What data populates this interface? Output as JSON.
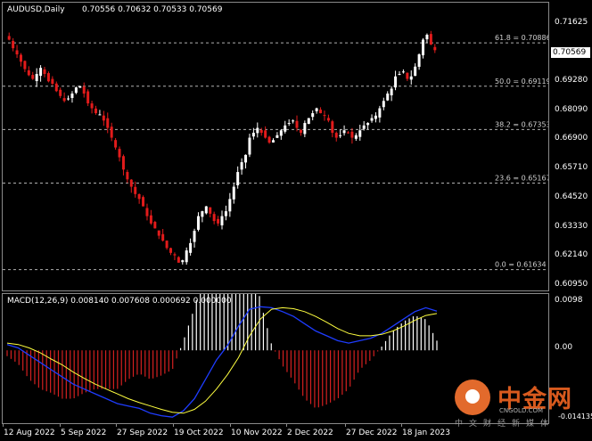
{
  "chart": {
    "symbol_label": "AUDUSD,Daily",
    "ohlc_label": "0.70556 0.70632 0.70533 0.70569",
    "current_price": "0.70569",
    "price_axis_labels": [
      "0.71625",
      "0.70569",
      "0.69280",
      "0.68090",
      "0.66900",
      "0.65710",
      "0.64520",
      "0.63330",
      "0.62140",
      "0.60950"
    ],
    "fib_levels": [
      {
        "label": "61.8 = 0.70886",
        "value": 0.70886
      },
      {
        "label": "50.0 = 0.69119",
        "value": 0.69119
      },
      {
        "label": "38.2 = 0.67353",
        "value": 0.67353
      },
      {
        "label": "23.6 = 0.65167",
        "value": 0.65167
      },
      {
        "label": "0.0 = 0.61634",
        "value": 0.61634
      }
    ],
    "date_labels": [
      "12 Aug 2022",
      "5 Sep 2022",
      "27 Sep 2022",
      "19 Oct 2022",
      "10 Nov 2022",
      "2 Dec 2022",
      "27 Dec 2022",
      "18 Jan 2023"
    ],
    "colors": {
      "bull": "#ffffff",
      "bear": "#e21b1b",
      "fib": "#b0b0b0",
      "macd_line": "#1e3cff",
      "signal_line": "#ffff40",
      "hist_pos": "#ffffff",
      "hist_neg": "#d42020",
      "frame": "#8a8a8a"
    }
  },
  "macd": {
    "label": "MACD(12,26,9) 0.008140 0.007608 0.000692 0.000000",
    "axis_labels": [
      "0.0098",
      "0.00",
      "-0.014135"
    ]
  },
  "watermark": {
    "name": "中金网",
    "url": "CNGOLD.COM",
    "slogan": "中文财经新媒体",
    "icon": "cngold-logo-icon"
  },
  "chart_data": [
    {
      "type": "candlestick",
      "title": "AUDUSD,Daily",
      "x_range": [
        "12 Aug 2022",
        "24 Jan 2023"
      ],
      "ylim": [
        0.6095,
        0.72
      ],
      "close_path": [
        0.71,
        0.7065,
        0.704,
        0.701,
        0.698,
        0.6955,
        0.694,
        0.696,
        0.6985,
        0.696,
        0.693,
        0.692,
        0.689,
        0.687,
        0.685,
        0.686,
        0.688,
        0.6905,
        0.691,
        0.688,
        0.684,
        0.682,
        0.68,
        0.6795,
        0.677,
        0.674,
        0.67,
        0.666,
        0.662,
        0.657,
        0.653,
        0.65,
        0.647,
        0.645,
        0.642,
        0.638,
        0.635,
        0.633,
        0.63,
        0.628,
        0.625,
        0.623,
        0.622,
        0.619,
        0.62,
        0.624,
        0.627,
        0.632,
        0.638,
        0.64,
        0.642,
        0.639,
        0.636,
        0.635,
        0.638,
        0.64,
        0.645,
        0.65,
        0.656,
        0.66,
        0.663,
        0.67,
        0.672,
        0.674,
        0.672,
        0.67,
        0.668,
        0.669,
        0.671,
        0.673,
        0.675,
        0.676,
        0.677,
        0.674,
        0.672,
        0.676,
        0.678,
        0.68,
        0.682,
        0.68,
        0.679,
        0.677,
        0.672,
        0.67,
        0.671,
        0.673,
        0.672,
        0.67,
        0.671,
        0.673,
        0.675,
        0.676,
        0.678,
        0.679,
        0.682,
        0.685,
        0.688,
        0.69,
        0.695,
        0.696,
        0.697,
        0.694,
        0.695,
        0.699,
        0.704,
        0.71,
        0.712,
        0.708,
        0.7057
      ]
    },
    {
      "type": "line",
      "title": "MACD(12,26,9)",
      "ylim": [
        -0.014135,
        0.0098
      ],
      "series": [
        {
          "name": "MACD",
          "values": [
            0.0012,
            0.0005,
            -0.001,
            -0.0025,
            -0.004,
            -0.0055,
            -0.007,
            -0.008,
            -0.009,
            -0.01,
            -0.011,
            -0.0115,
            -0.012,
            -0.013,
            -0.0135,
            -0.0138,
            -0.0125,
            -0.01,
            -0.006,
            -0.002,
            0.001,
            0.005,
            0.0085,
            0.009,
            0.0088,
            0.008,
            0.007,
            0.0055,
            0.004,
            0.003,
            0.002,
            0.0015,
            0.002,
            0.0025,
            0.0035,
            0.005,
            0.0065,
            0.008,
            0.0088,
            0.0081
          ]
        },
        {
          "name": "Signal",
          "values": [
            0.0015,
            0.0012,
            0.0005,
            -0.0005,
            -0.0018,
            -0.003,
            -0.0045,
            -0.0058,
            -0.007,
            -0.008,
            -0.009,
            -0.01,
            -0.0108,
            -0.0115,
            -0.0122,
            -0.0128,
            -0.013,
            -0.0122,
            -0.0105,
            -0.008,
            -0.005,
            -0.0015,
            0.003,
            0.0065,
            0.0085,
            0.0088,
            0.0086,
            0.008,
            0.007,
            0.0058,
            0.0045,
            0.0035,
            0.003,
            0.003,
            0.0033,
            0.004,
            0.005,
            0.0062,
            0.0072,
            0.0076
          ]
        }
      ]
    }
  ]
}
